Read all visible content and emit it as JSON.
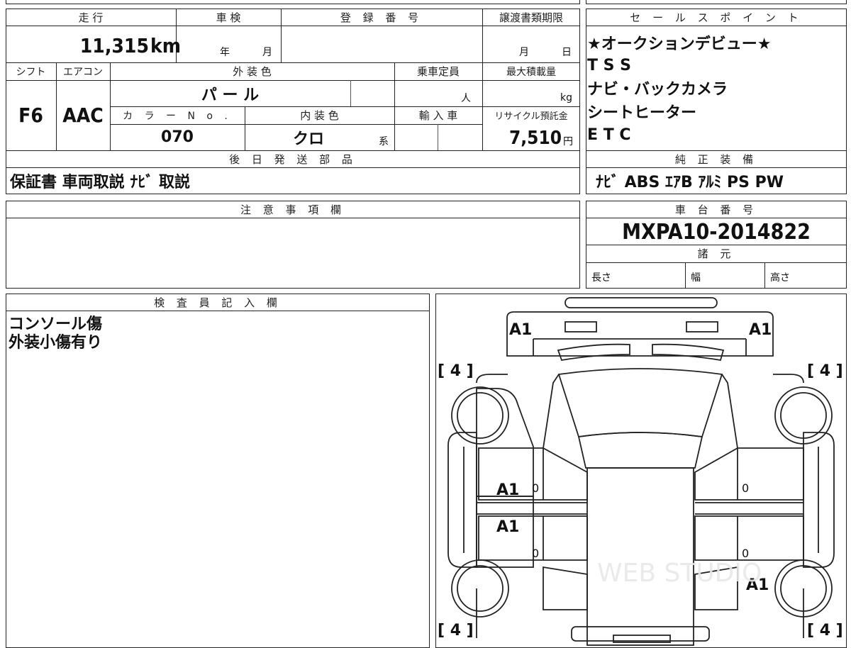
{
  "top_table": {
    "mileage_label": "走 行",
    "mileage_value": "11,315",
    "mileage_unit": "km",
    "inspection_label": "車 検",
    "inspection_year": "年",
    "inspection_month": "月",
    "registration_label": "登 録 番 号",
    "transfer_label": "譲渡書類期限",
    "transfer_month": "月",
    "transfer_day": "日",
    "shift_label": "シフト",
    "shift_value": "F6",
    "ac_label": "エアコン",
    "ac_value": "AAC",
    "exterior_color_label": "外 装 色",
    "exterior_color_value": "パ ー ル",
    "capacity_label": "乗車定員",
    "capacity_unit": "人",
    "max_load_label": "最大積載量",
    "max_load_unit": "kg",
    "color_no_label": "カ ラ ー N o .",
    "color_no_value": "070",
    "interior_color_label": "内 装 色",
    "interior_color_value": "クロ",
    "interior_color_suffix": "系",
    "import_label": "輸 入 車",
    "recycle_label": "リサイクル預託金",
    "recycle_value": "7,510",
    "recycle_unit": "円",
    "later_parts_label": "後 日 発 送 部 品",
    "later_parts_value": "保証書 車両取説 ﾅﾋﾞ 取説"
  },
  "sales_points": {
    "label": "セ ー ル ス ポ イ ン ト",
    "items": [
      "★オークションデビュー★",
      "T S S",
      "ナビ・バックカメラ",
      "シートヒーター",
      "E T C"
    ]
  },
  "equipment": {
    "label": "純 正 装 備",
    "value": "ﾅﾋﾞ ABS ｴｱB ｱﾙﾐ PS PW"
  },
  "notes": {
    "label": "注 意 事 項 欄"
  },
  "chassis": {
    "label": "車 台 番 号",
    "value": "MXPA10-2014822",
    "specs_label": "諸 元",
    "length_label": "長さ",
    "width_label": "幅",
    "height_label": "高さ"
  },
  "inspector": {
    "label": "検 査 員 記 入 欄",
    "lines": [
      "コンソール傷",
      "外装小傷有り"
    ]
  },
  "diagram": {
    "marks": {
      "a1_front_left": "A1",
      "a1_front_right": "A1",
      "a1_door_front_left": "A1",
      "a1_door_rear_left": "A1",
      "a1_rear_right": "A1",
      "tire_front_left": "[ 4 ]",
      "tire_front_right": "[ 4 ]",
      "tire_rear_left": "[ 4 ]",
      "tire_rear_right": "[ 4 ]",
      "zero_1": "0",
      "zero_2": "0",
      "zero_3": "0",
      "zero_4": "0"
    },
    "watermark": "WEB STUDIO"
  }
}
